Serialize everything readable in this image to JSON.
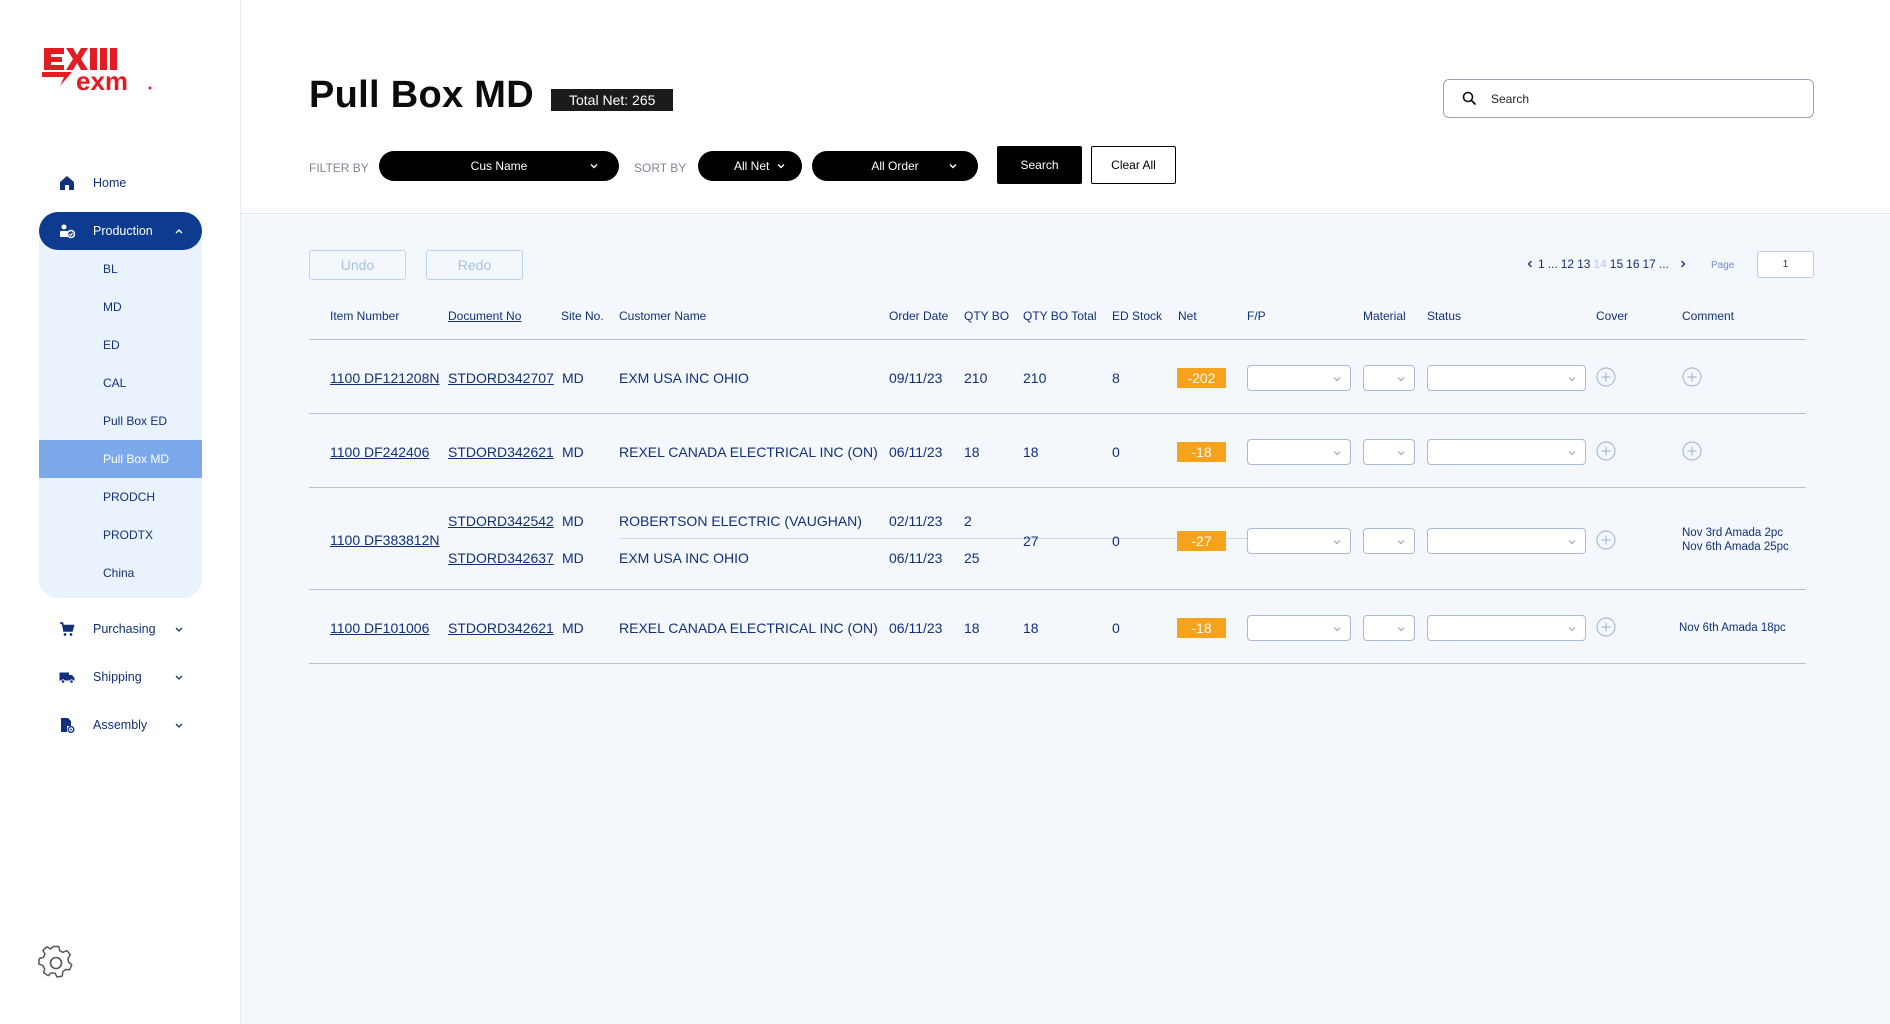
{
  "app": {
    "logo_text": "EXM exm"
  },
  "sidebar": {
    "home": "Home",
    "production": "Production",
    "production_items": [
      "BL",
      "MD",
      "ED",
      "CAL",
      "Pull Box ED",
      "Pull Box MD",
      "PRODCH",
      "PRODTX",
      "China"
    ],
    "active_item": "Pull Box MD",
    "purchasing": "Purchasing",
    "shipping": "Shipping",
    "assembly": "Assembly"
  },
  "header": {
    "title": "Pull Box MD",
    "total_badge": "Total Net: 265",
    "search_placeholder": "Search",
    "filter_by_label": "FILTER BY",
    "filter_value": "Cus Name",
    "sort_by_label": "SORT BY",
    "sort_net": "All Net",
    "sort_order": "All Order",
    "search_button": "Search",
    "clear_button": "Clear All"
  },
  "toolbar": {
    "undo": "Undo",
    "redo": "Redo",
    "pager": {
      "first": "1",
      "dots1": "...",
      "p12": "12",
      "p13": "13",
      "current": "14",
      "p15": "15",
      "p16": "16",
      "p17": "17",
      "dots2": "..."
    },
    "page_label": "Page",
    "page_value": "1"
  },
  "table": {
    "columns": [
      "Item Number",
      "Document No",
      "Site No.",
      "Customer Name",
      "Order Date",
      "QTY BO",
      "QTY BO Total",
      "ED Stock",
      "Net",
      "F/P",
      "Material",
      "Status",
      "Cover",
      "Comment"
    ],
    "rows": [
      {
        "item": "1100 DF121208N",
        "orders": [
          {
            "doc": "STDORD342707",
            "site": "MD",
            "customer": "EXM USA INC OHIO",
            "date": "09/11/23",
            "qty_bo": "210"
          }
        ],
        "qty_total": "210",
        "ed_stock": "8",
        "net": "-202",
        "comment": [
          "",
          ""
        ]
      },
      {
        "item": "1100 DF242406",
        "orders": [
          {
            "doc": "STDORD342621",
            "site": "MD",
            "customer": "REXEL CANADA ELECTRICAL INC (ON)",
            "date": "06/11/23",
            "qty_bo": "18"
          }
        ],
        "qty_total": "18",
        "ed_stock": "0",
        "net": "-18",
        "comment": [
          "",
          ""
        ]
      },
      {
        "item": "1100 DF383812N",
        "orders": [
          {
            "doc": "STDORD342542",
            "site": "MD",
            "customer": "ROBERTSON ELECTRIC (VAUGHAN)",
            "date": "02/11/23",
            "qty_bo": "2"
          },
          {
            "doc": "STDORD342637",
            "site": "MD",
            "customer": "EXM USA INC OHIO",
            "date": "06/11/23",
            "qty_bo": "25"
          }
        ],
        "qty_total": "27",
        "ed_stock": "0",
        "net": "-27",
        "comment": [
          "Nov 3rd Amada 2pc",
          "Nov 6th Amada 25pc"
        ]
      },
      {
        "item": "1100 DF101006",
        "orders": [
          {
            "doc": "STDORD342621",
            "site": "MD",
            "customer": "REXEL CANADA ELECTRICAL INC (ON)",
            "date": "06/11/23",
            "qty_bo": "18"
          }
        ],
        "qty_total": "18",
        "ed_stock": "0",
        "net": "-18",
        "comment": [
          "Nov 6th Amada 18pc",
          ""
        ]
      }
    ]
  },
  "colors": {
    "brand_red": "#e31b23",
    "nav_blue": "#0d3b8f",
    "active_item": "#7ba9ea",
    "net_badge": "#f7a21b",
    "text_blue": "#10307a"
  }
}
